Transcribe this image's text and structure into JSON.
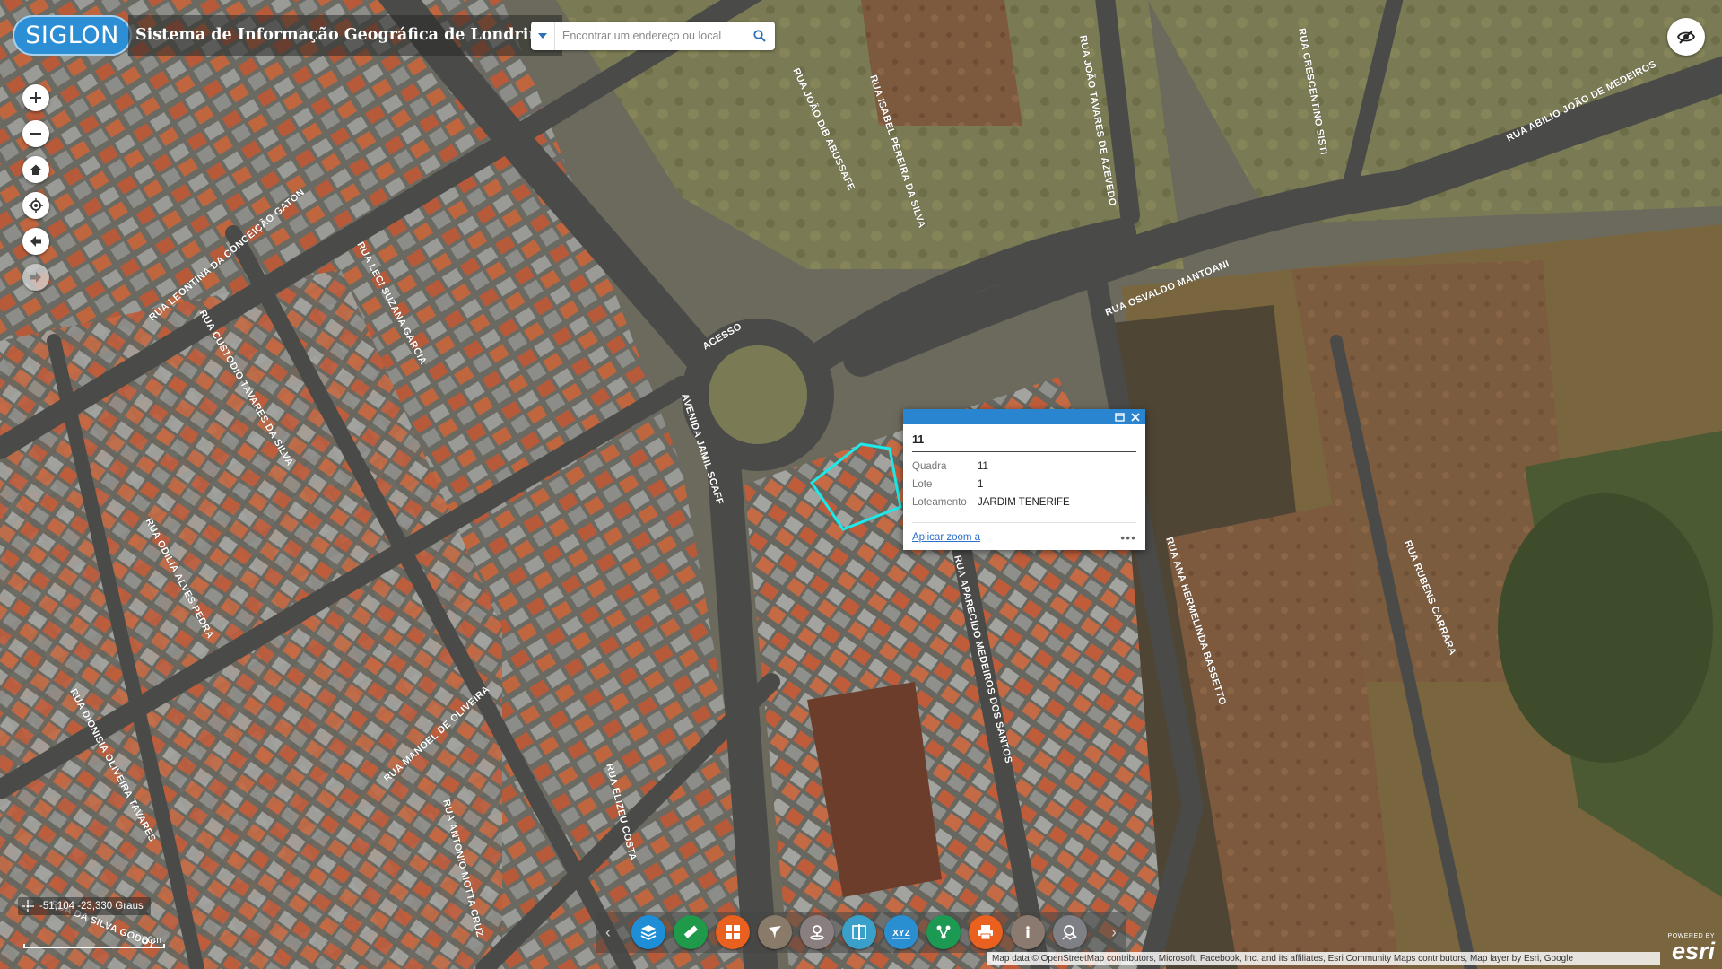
{
  "header": {
    "logo_text": "SIGLON",
    "title": "Sistema de Informação Geográfica de Londrina",
    "search_placeholder": "Encontrar um endereço ou local"
  },
  "zoom_tools": [
    {
      "name": "zoom-in",
      "icon": "plus-icon"
    },
    {
      "name": "zoom-out",
      "icon": "minus-icon"
    },
    {
      "name": "default-extent",
      "icon": "home-icon"
    },
    {
      "name": "my-location",
      "icon": "locate-icon"
    },
    {
      "name": "previous-extent",
      "icon": "arrow-left-icon"
    },
    {
      "name": "next-extent",
      "icon": "arrow-right-icon"
    }
  ],
  "streets": [
    "RUA JOÃO DIB ABUSSAFE",
    "RUA ISABEL PEREIRA DA SILVA",
    "RUA JOÃO TAVARES DE AZEVEDO",
    "RUA CRESCENTINO SISTI",
    "RUA ABILIO JOÃO DE MEDEIROS",
    "RUA LEONTINA DA CONCEIÇÃO GATON",
    "RUA LECI SUZANA GARCIA",
    "RUA CUSTODIO TAVARES DA SILVA",
    "RUA OSVALDO MANTOANI",
    "ACESSO",
    "AVENIDA JAMIL SCAFF",
    "RUA ODILIA ALVES PEDRA",
    "RUA APARECIDO MEDEIROS DOS SANTOS",
    "RUA ANA HERMELINDA BASSETTO",
    "RUA RUBENS CARRARA",
    "RUA DIONISIA OLIVEIRA TAVARES",
    "RUA MANOEL DE OLIVEIRA",
    "RUA ELIZEU COSTA",
    "RUA ANTONIO MOTTA CRUZ",
    "RUA DA SILVA GODOY"
  ],
  "popup": {
    "title": "11",
    "fields": [
      {
        "key": "Quadra",
        "value": "11"
      },
      {
        "key": "Lote",
        "value": "1"
      },
      {
        "key": "Loteamento",
        "value": "JARDIM TENERIFE"
      }
    ],
    "zoom_link": "Aplicar zoom a",
    "more": "•••"
  },
  "toolbar": [
    {
      "name": "layers",
      "icon": "layers-icon",
      "color": "#1e8fd6"
    },
    {
      "name": "measure",
      "icon": "ruler-icon",
      "color": "#1e9a4a"
    },
    {
      "name": "basemap-gallery",
      "icon": "grid-icon",
      "color": "#e9601f"
    },
    {
      "name": "draw",
      "icon": "pen-icon",
      "color": "#8a7a6a"
    },
    {
      "name": "location",
      "icon": "map-pin-icon",
      "color": "#8a7f80"
    },
    {
      "name": "swipe",
      "icon": "compare-icon",
      "color": "#3aa0c9"
    },
    {
      "name": "coordinates",
      "icon": "xyz-icon",
      "color": "#2a8fd0"
    },
    {
      "name": "routes",
      "icon": "route-icon",
      "color": "#1c9a54"
    },
    {
      "name": "print",
      "icon": "printer-icon",
      "color": "#e9601f"
    },
    {
      "name": "about",
      "icon": "info-icon",
      "color": "#8a7a70"
    },
    {
      "name": "query",
      "icon": "search-map-icon",
      "color": "#7f7f86"
    }
  ],
  "coords": "-51,104 -23,330 Graus",
  "scale_label": "30m",
  "attribution": "Map data © OpenStreetMap contributors, Microsoft, Facebook, Inc. and its affiliates, Esri Community Maps contributors, Map layer by Esri, Google",
  "esri": {
    "powered": "POWERED BY",
    "name": "esri"
  }
}
